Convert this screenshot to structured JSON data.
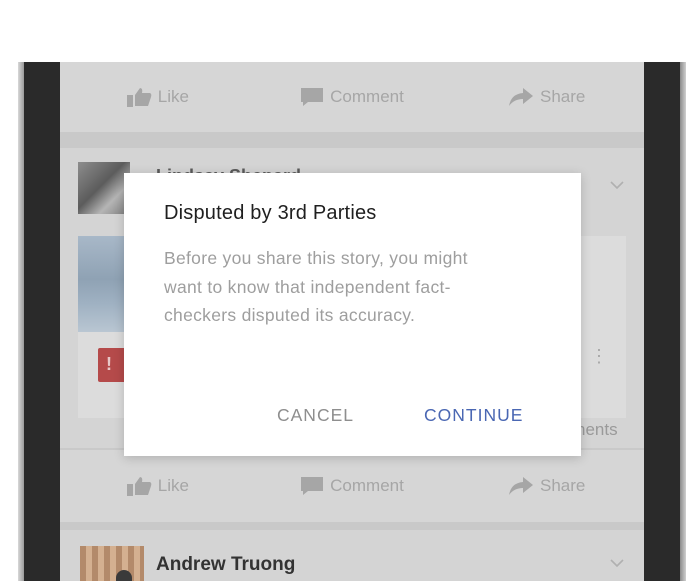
{
  "feed": {
    "actions": {
      "like": "Like",
      "comment": "Comment",
      "share": "Share"
    },
    "post": {
      "author": "Lindsay Shepard",
      "comments_text": "nents"
    },
    "next_post": {
      "author": "Andrew Truong"
    }
  },
  "dialog": {
    "title": "Disputed by 3rd Parties",
    "body": "Before you share this story, you might want to know that independent fact-checkers disputed its accuracy.",
    "cancel_label": "CANCEL",
    "continue_label": "CONTINUE"
  },
  "icons": {
    "like": "thumbs-up-icon",
    "comment": "comment-bubble-icon",
    "share": "share-arrow-icon",
    "warning": "warning-triangle-icon",
    "chevron": "chevron-down-icon"
  },
  "colors": {
    "accent": "#4a67b3",
    "dialog_bg": "#ffffff",
    "overlay": "#c9c9c9",
    "title_text": "#1f1f1f",
    "body_text": "#9e9e9e"
  }
}
